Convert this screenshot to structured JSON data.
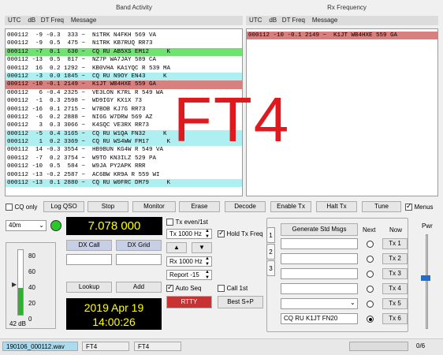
{
  "band_activity": {
    "title": "Band Activity",
    "header": "UTC    dB   DT Freq    Message",
    "rows": [
      {
        "text": "000112  -9 -0.3  333 ~  N1TRK N4FKH 569 VA",
        "hl": ""
      },
      {
        "text": "000112  -9  0.5  475 ~  N1TRK KB7RUQ RR73",
        "hl": ""
      },
      {
        "text": "000112  -7  0.1  630 ~  CQ RU AB5XS EM12     K",
        "hl": "green"
      },
      {
        "text": "000112 -13  0.5  817 ~  NZ7P WA7JAY 589 CA",
        "hl": ""
      },
      {
        "text": "000112  16  0.2 1292 ~  KB0VHA KA1YQC R 539 MA",
        "hl": ""
      },
      {
        "text": "000112  -3  0.0 1845 ~  CQ RU N9OY EN43     K",
        "hl": "cyan"
      },
      {
        "text": "000112 -10 -0.1 2149 ~  K1JT WB4HXE 559 GA",
        "hl": "red"
      },
      {
        "text": "000112   6 -0.4 2325 ~  VE3LON K7RL R 549 WA",
        "hl": ""
      },
      {
        "text": "000112  -1  0.3 2598 ~  WD9IGY KX1X 73",
        "hl": ""
      },
      {
        "text": "000112 -16  0.1 2715 ~  W7BOB KJ7G RR73",
        "hl": ""
      },
      {
        "text": "000112  -6  0.2 2888 ~  NI6G W7DRW 569 AZ",
        "hl": ""
      },
      {
        "text": "000112   3  0.3 3066 ~  K4SQC VE3RX RR73",
        "hl": ""
      },
      {
        "text": "000112  -5  0.4 3165 ~  CQ RU W1QA FN32     K",
        "hl": "cyan"
      },
      {
        "text": "000112   1  0.2 3369 ~  CQ RU WS4WW FM17     K",
        "hl": "cyan"
      },
      {
        "text": "000112  14 -0.3 3554 ~  HB9BUN KG4W R 549 VA",
        "hl": ""
      },
      {
        "text": "000112  -7  0.2 3754 ~  W9TO KN3ILZ 529 PA",
        "hl": ""
      },
      {
        "text": "000112 -10  0.5  584 ~  W9JA PY2APK RRR",
        "hl": ""
      },
      {
        "text": "000112 -13 -0.2 2587 ~  AC6BW KR9A R 559 WI",
        "hl": ""
      },
      {
        "text": "000112 -13  0.1 2880 ~  CQ RU W0FRC DM79     K",
        "hl": "cyan"
      }
    ]
  },
  "rx_frequency": {
    "title": "Rx Frequency",
    "header": "UTC    dB   DT Freq    Message",
    "rows": [
      {
        "text": "000112 -10 -0.1 2149 ~  K1JT WB4HXE 559 GA",
        "hl": "red"
      }
    ]
  },
  "mode_overlay": {
    "text": "FT4",
    "color": "#e0191e"
  },
  "buttons": {
    "cq_only": "CQ only",
    "log_qso": "Log QSO",
    "stop": "Stop",
    "monitor": "Monitor",
    "erase": "Erase",
    "decode": "Decode",
    "enable_tx": "Enable Tx",
    "halt_tx": "Halt Tx",
    "tune": "Tune",
    "menus": "Menus"
  },
  "band": {
    "value": "40m",
    "frequency": "7.078 000"
  },
  "dx": {
    "call_label": "DX Call",
    "grid_label": "DX Grid",
    "call_value": "",
    "grid_value": ""
  },
  "controls": {
    "lookup": "Lookup",
    "add": "Add",
    "tx_even": "Tx even/1st",
    "tx_freq": "Tx  1000 Hz",
    "hold_tx_freq": "Hold Tx Freq",
    "rx_freq": "Rx  1000 Hz",
    "report": "Report -15",
    "auto_seq": "Auto Seq",
    "call_1st": "Call 1st",
    "rtty": "RTTY",
    "best_sp": "Best S+P"
  },
  "clock": {
    "date": "2019 Apr 19",
    "time": "14:00:26"
  },
  "meter": {
    "ticks": [
      "80",
      "60",
      "40",
      "20",
      "0"
    ],
    "db_label": "42 dB",
    "level": 0.42
  },
  "tx_messages": {
    "tabs": [
      "1",
      "2",
      "3"
    ],
    "generate_label": "Generate Std Msgs",
    "next_label": "Next",
    "now_label": "Now",
    "messages": [
      {
        "text": "",
        "tx": "Tx 1",
        "selected": false
      },
      {
        "text": "",
        "tx": "Tx 2",
        "selected": false
      },
      {
        "text": "",
        "tx": "Tx 3",
        "selected": false
      },
      {
        "text": "",
        "tx": "Tx 4",
        "selected": false
      },
      {
        "text": "",
        "tx": "Tx 5",
        "selected": false
      },
      {
        "text": "CQ RU K1JT FN20",
        "tx": "Tx 6",
        "selected": true
      }
    ]
  },
  "pwr_label": "Pwr",
  "status_bar": {
    "file": "190106_000112.wav",
    "mode": "FT4",
    "mode2": "FT4",
    "progress_text": "0/6"
  },
  "colors": {
    "accent_red": "#c83232",
    "meter_green": "#2fb02f",
    "led_green": "#28c828",
    "blue_thumb": "#1f6fd0"
  }
}
